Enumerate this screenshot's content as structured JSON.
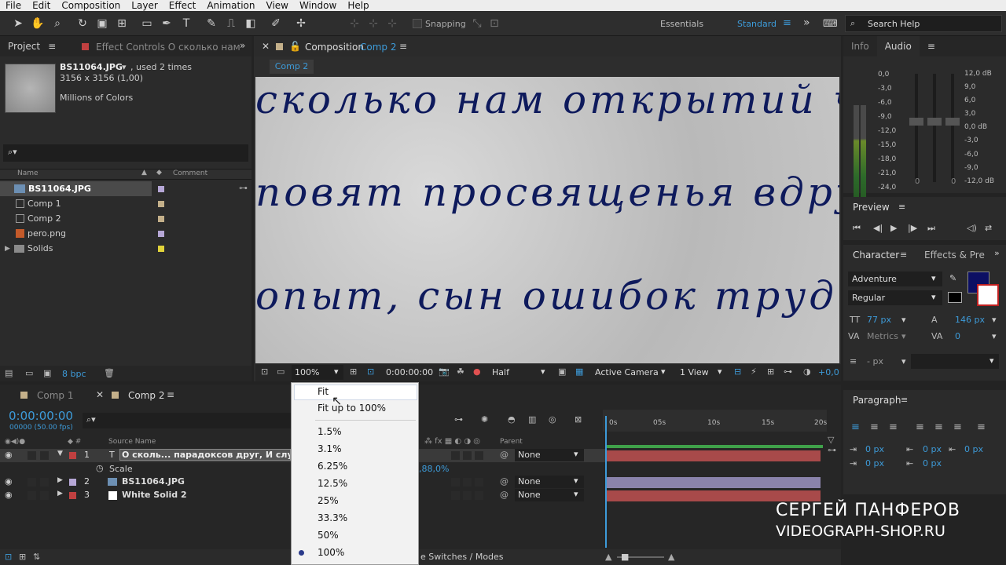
{
  "menu": [
    "File",
    "Edit",
    "Composition",
    "Layer",
    "Effect",
    "Animation",
    "View",
    "Window",
    "Help"
  ],
  "toolbar": {
    "snapping": "Snapping",
    "essentials": "Essentials",
    "standard": "Standard",
    "search_placeholder": "Search Help"
  },
  "project": {
    "tab": "Project",
    "effect_tab": "Effect Controls О сколько нам",
    "asset_name": "BS11064.JPG",
    "asset_used": ", used 2 times",
    "asset_dims": "3156 x 3156 (1,00)",
    "asset_colors": "Millions of Colors",
    "col_name": "Name",
    "col_comment": "Comment",
    "items": [
      {
        "name": "BS11064.JPG",
        "color": "#b6a7d6"
      },
      {
        "name": "Comp 1",
        "color": "#c4b08a"
      },
      {
        "name": "Comp 2",
        "color": "#c4b08a"
      },
      {
        "name": "pero.png",
        "color": "#b6a7d6"
      },
      {
        "name": "Solids",
        "color": "#e1d33a"
      }
    ],
    "bpc": "8 bpc"
  },
  "composition": {
    "tab": "Composition",
    "comp_name": "Comp 2",
    "breadcrumb": "Comp 2",
    "lines": [
      "сколько нам открытий ч",
      "повят просвященья вдруг",
      "опыт, сын ошибок трудн"
    ],
    "zoom": "100%",
    "timecode": "0:00:00:00",
    "resolution": "Half",
    "camera": "Active Camera",
    "view": "1 View",
    "exposure": "+0,0"
  },
  "right": {
    "info_tab": "Info",
    "audio_tab": "Audio",
    "audio_left": [
      "0,0",
      "-3,0",
      "-6,0",
      "-9,0",
      "-12,0",
      "-15,0",
      "-18,0",
      "-21,0",
      "-24,0"
    ],
    "audio_right": [
      "12,0 dB",
      "9,0",
      "6,0",
      "3,0",
      "0,0 dB",
      "-3,0",
      "-6,0",
      "-9,0",
      "-12,0 dB"
    ],
    "audio_zero_l": "0",
    "audio_zero_r": "0",
    "preview_tab": "Preview",
    "character_tab": "Character",
    "effects_tab": "Effects & Pre",
    "font": "Adventure",
    "style": "Regular",
    "size": "77 px",
    "leading": "146 px",
    "kerning": "Metrics",
    "tracking": "0",
    "stroke": "- px",
    "paragraph_tab": "Paragraph",
    "indent_vals": [
      "0 px",
      "0 px",
      "0 px",
      "0 px",
      "0 px"
    ]
  },
  "timeline": {
    "tab1": "Comp 1",
    "tab2": "Comp 2",
    "timecode": "0:00:00:00",
    "fps": "00000 (50.00 fps)",
    "col_source": "Source Name",
    "col_parent": "Parent",
    "ticks": [
      "0s",
      "05s",
      "10s",
      "15s",
      "20s"
    ],
    "layers": [
      {
        "num": "1",
        "name": "О сколь... парадоксов друг, И случай",
        "parent": "None",
        "color": "#c04040"
      },
      {
        "num": "2",
        "name": "BS11064.JPG",
        "parent": "None",
        "color": "#b6a7d6"
      },
      {
        "num": "3",
        "name": "White Solid 2",
        "parent": "None",
        "color": "#c04040"
      }
    ],
    "scale_label": "Scale",
    "scale_value": ",88,0%",
    "switches": "e Switches / Modes"
  },
  "zoom_menu": {
    "items": [
      "Fit",
      "Fit up to 100%",
      "1.5%",
      "3.1%",
      "6.25%",
      "12.5%",
      "25%",
      "33.3%",
      "50%",
      "100%"
    ],
    "selected": "100%"
  },
  "watermark": {
    "line1": "СЕРГЕЙ ПАНФЕРОВ",
    "line2": "VIDEOGRAPH-SHOP.RU"
  }
}
